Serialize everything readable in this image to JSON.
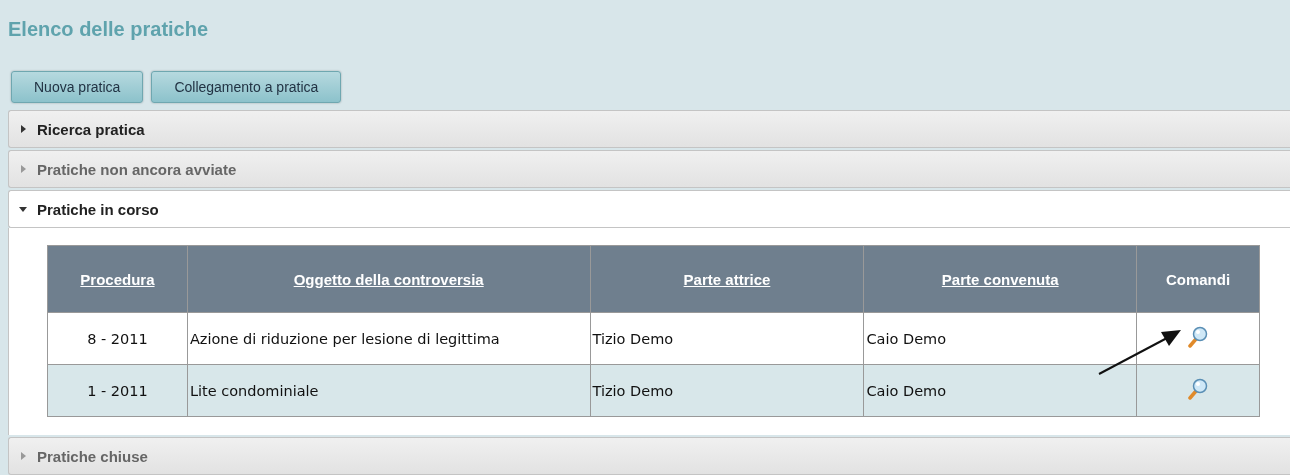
{
  "title": "Elenco delle pratiche",
  "buttons": [
    "Nuova pratica",
    "Collegamento a pratica"
  ],
  "sections": [
    {
      "label": "Ricerca pratica",
      "expanded": false,
      "disabled": false
    },
    {
      "label": "Pratiche non ancora avviate",
      "expanded": false,
      "disabled": true
    },
    {
      "label": "Pratiche in corso",
      "expanded": true,
      "disabled": false,
      "table": {
        "columns": [
          {
            "label": "Procedura",
            "sortable": true
          },
          {
            "label": "Oggetto della controversia",
            "sortable": true
          },
          {
            "label": "Parte attrice",
            "sortable": true
          },
          {
            "label": "Parte convenuta",
            "sortable": true
          },
          {
            "label": "Comandi",
            "sortable": false
          }
        ],
        "rows": [
          {
            "procedura": "8 - 2011",
            "oggetto": "Azione di riduzione per lesione di legittima",
            "attrice": "Tizio Demo",
            "convenuta": "Caio Demo"
          },
          {
            "procedura": "1 - 2011",
            "oggetto": "Lite condominiale",
            "attrice": "Tizio Demo",
            "convenuta": "Caio Demo"
          }
        ]
      }
    },
    {
      "label": "Pratiche chiuse",
      "expanded": false,
      "disabled": true
    }
  ]
}
